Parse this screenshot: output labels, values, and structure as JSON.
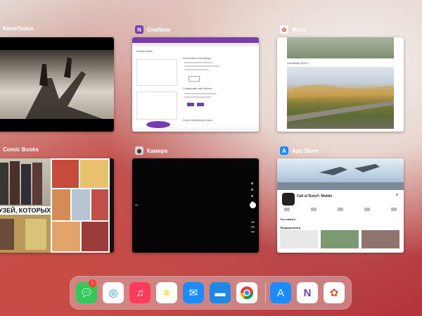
{
  "switcher": {
    "apps": [
      {
        "name": "КиноПоиск"
      },
      {
        "name": "OneNote"
      },
      {
        "name": "Фото"
      },
      {
        "name": "Comic Books"
      },
      {
        "name": "Камера"
      },
      {
        "name": "App Store"
      }
    ]
  },
  "previews": {
    "onenote": {
      "title": "Simple Basic",
      "h1": "Remember everything",
      "h2": "Collaborate with others",
      "h3": "Keep everything in sync"
    },
    "photo": {
      "caption": "Сентябрь 2021 г."
    },
    "comic": {
      "headline": "УЗЕЙ, КОТОРЫХ НЕТ"
    },
    "appstore": {
      "app_name": "Call of Duty®: Mobile",
      "section1": "Что нового",
      "section2": "Предпросмотр"
    }
  },
  "dock": {
    "items": [
      {
        "name": "messages-app",
        "icon": "message-icon",
        "badge": "1"
      },
      {
        "name": "safari-app",
        "icon": "compass-icon"
      },
      {
        "name": "music-app",
        "icon": "music-note-icon"
      },
      {
        "name": "notes-app",
        "icon": "notes-icon"
      },
      {
        "name": "mail-app",
        "icon": "envelope-icon"
      },
      {
        "name": "files-app",
        "icon": "folder-icon"
      },
      {
        "name": "chrome-app",
        "icon": "chrome-icon"
      },
      {
        "name": "app-store-app",
        "icon": "app-store-icon"
      },
      {
        "name": "onenote-app",
        "icon": "onenote-icon"
      },
      {
        "name": "photos-app",
        "icon": "flower-icon"
      }
    ]
  }
}
